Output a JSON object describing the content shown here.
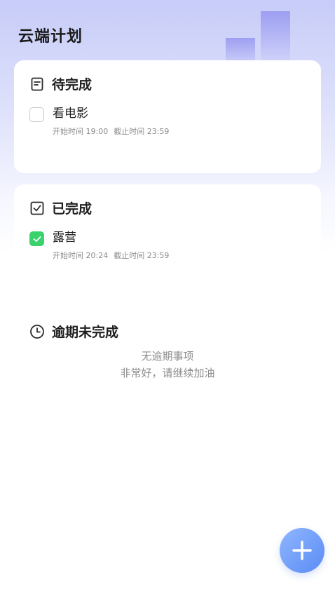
{
  "app": {
    "title": "云端计划"
  },
  "pending": {
    "title": "待完成",
    "icon": "document-icon",
    "tasks": [
      {
        "name": "看电影",
        "start": "开始时间 19:00",
        "deadline": "截止时间 23:59",
        "checked": false
      }
    ]
  },
  "completed": {
    "title": "已完成",
    "icon": "checked-square-icon",
    "tasks": [
      {
        "name": "露营",
        "start": "开始时间 20:24",
        "deadline": "截止时间 23:59",
        "checked": true
      }
    ]
  },
  "overdue": {
    "title": "逾期未完成",
    "icon": "clock-icon",
    "empty_line1": "无逾期事项",
    "empty_line2": "非常好，请继续加油"
  },
  "fab": {
    "icon": "plus-icon"
  },
  "colors": {
    "accent_green": "#39d26b",
    "fab_blue": "#5b8cf4",
    "header_gradient": "#c7ccf8"
  }
}
